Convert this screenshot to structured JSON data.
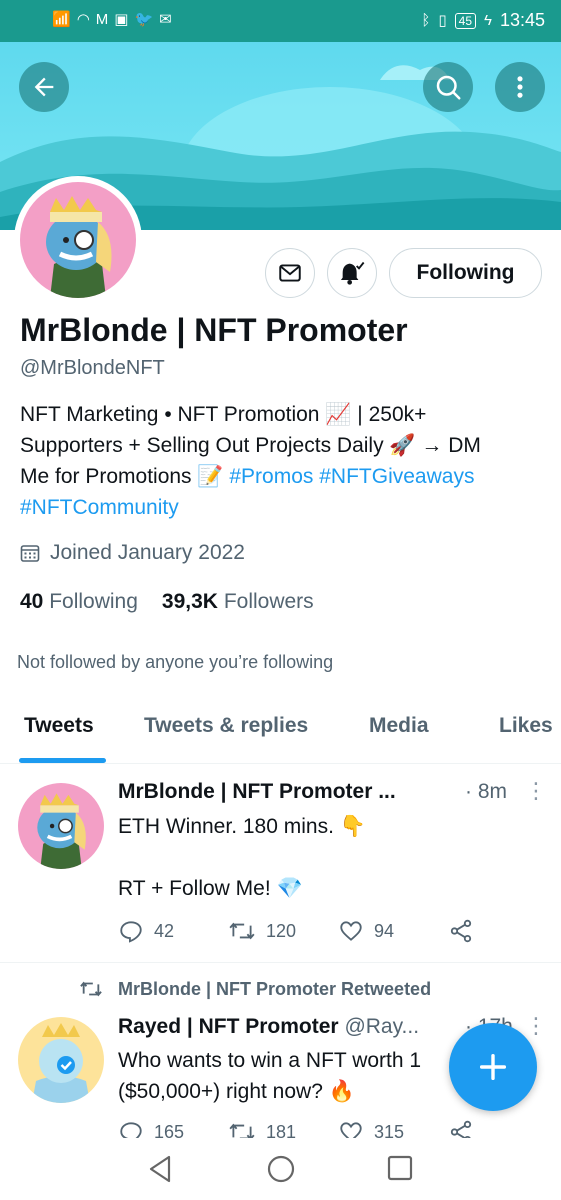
{
  "status_bar": {
    "time": "13:45",
    "battery": "45",
    "icons": [
      "signal-icon",
      "wifi-icon",
      "gmail-icon",
      "outlook-icon",
      "twitter-icon",
      "mail-icon",
      "bluetooth-icon",
      "vibrate-icon",
      "charging-icon"
    ]
  },
  "header": {
    "back_icon": "arrow-left-icon",
    "search_icon": "search-icon",
    "more_icon": "more-vertical-icon"
  },
  "profile": {
    "name": "MrBlonde | NFT Promoter",
    "handle": "@MrBlondeNFT",
    "bio_line1": "NFT Marketing • NFT Promotion 📈 | 250k+",
    "bio_line2": "Supporters + Selling Out Projects Daily 🚀 → DM",
    "bio_line3_text": "Me for Promotions 📝 ",
    "bio_tag1": "#Promos",
    "bio_tag2": "#NFTGiveaways",
    "bio_tag3": "#NFTCommunity",
    "joined": "Joined January 2022",
    "following_count": "40",
    "following_label": "Following",
    "followers_count": "39,3K",
    "followers_label": "Followers",
    "not_followed": "Not followed by anyone you’re following",
    "following_button": "Following"
  },
  "tabs": [
    {
      "label": "Tweets",
      "active": true
    },
    {
      "label": "Tweets & replies",
      "active": false
    },
    {
      "label": "Media",
      "active": false
    },
    {
      "label": "Likes",
      "active": false
    }
  ],
  "tweets": [
    {
      "name": "MrBlonde | NFT Promoter ...",
      "time": "· 8m",
      "text": "ETH Winner. 180 mins. 👇\n\nRT + Follow Me! 💎",
      "replies": "42",
      "retweets": "120",
      "likes": "94"
    },
    {
      "retweet_label": "MrBlonde | NFT Promoter Retweeted",
      "name": "Rayed | NFT Promoter",
      "handle": "@Ray...",
      "time": "· 17h",
      "text": "Who wants to win a NFT worth 1\n($50,000+) right now? 🔥",
      "replies": "165",
      "retweets": "181",
      "likes": "315"
    }
  ],
  "colors": {
    "accent": "#1d9bf0",
    "banner_teal": "#1a9a8e",
    "banner_sky": "#66e3f5",
    "text_secondary": "#536471"
  }
}
